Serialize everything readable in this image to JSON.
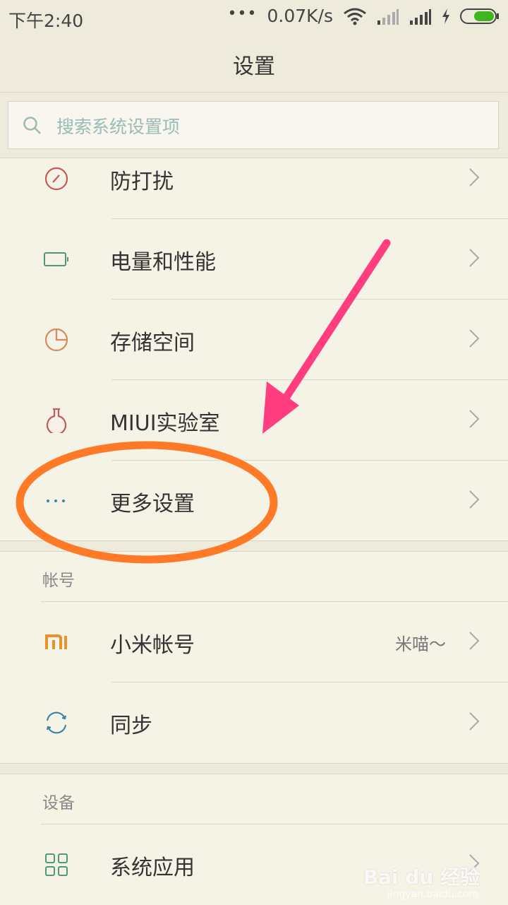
{
  "status_bar": {
    "time": "下午2:40",
    "dots": "•••",
    "net_speed": "0.07K/s"
  },
  "header": {
    "title": "设置"
  },
  "search": {
    "placeholder": "搜索系统设置项"
  },
  "group1": {
    "items": [
      {
        "label": "防打扰",
        "icon": "do-not-disturb-icon"
      },
      {
        "label": "电量和性能",
        "icon": "battery-icon"
      },
      {
        "label": "存储空间",
        "icon": "storage-pie-icon"
      },
      {
        "label": "MIUI实验室",
        "icon": "flask-icon"
      },
      {
        "label": "更多设置",
        "icon": "more-dots-icon"
      }
    ]
  },
  "account_section": {
    "title": "帐号",
    "items": [
      {
        "label": "小米帐号",
        "value": "米喵～",
        "icon": "mi-logo-icon"
      },
      {
        "label": "同步",
        "icon": "sync-icon"
      }
    ]
  },
  "device_section": {
    "title": "设备",
    "items": [
      {
        "label": "系统应用",
        "icon": "apps-grid-icon"
      }
    ]
  },
  "watermark": {
    "brand": "Bai du 经验",
    "url": "jingyan.baidu.com"
  },
  "colors": {
    "background": "#f5f2e6",
    "annotation_arrow": "#ff3d7f",
    "annotation_circle": "#ff7a26"
  }
}
